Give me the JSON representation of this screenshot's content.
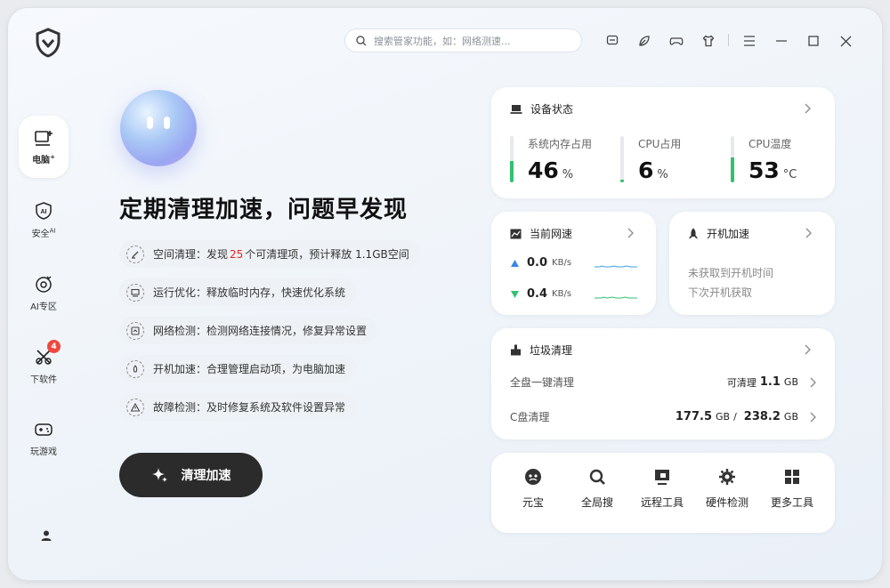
{
  "search": {
    "placeholder": "搜索管家功能，如：网络测速..."
  },
  "titlebar_icons": [
    "feedback-icon",
    "skin-icon",
    "game-controller-icon",
    "shirt-icon",
    "menu-icon",
    "minimize-icon",
    "maximize-icon",
    "close-icon"
  ],
  "sidebar": {
    "items": [
      {
        "label": "电脑",
        "sup": "+",
        "icon": "monitor-plus-icon",
        "active": true
      },
      {
        "label": "安全",
        "sup": "AI",
        "icon": "ai-shield-icon"
      },
      {
        "label": "AI专区",
        "icon": "ai-zone-icon"
      },
      {
        "label": "下软件",
        "icon": "download-software-icon",
        "badge": "4"
      },
      {
        "label": "玩游戏",
        "icon": "gamepad-icon"
      }
    ]
  },
  "main": {
    "headline": "定期清理加速，问题早发现",
    "features": [
      {
        "prefix": "空间清理：发现 ",
        "highlight": "25",
        "suffix": " 个可清理项，预计释放 1.1GB空间"
      },
      {
        "prefix": "运行优化：释放临时内存，快速优化系统",
        "highlight": "",
        "suffix": ""
      },
      {
        "prefix": "网络检测：检测网络连接情况，修复异常设置",
        "highlight": "",
        "suffix": ""
      },
      {
        "prefix": "开机加速：合理管理启动项，为电脑加速",
        "highlight": "",
        "suffix": ""
      },
      {
        "prefix": "故障检测：及时修复系统及软件设置异常",
        "highlight": "",
        "suffix": ""
      }
    ],
    "cta": "清理加速"
  },
  "device": {
    "title": "设备状态",
    "stats": [
      {
        "label": "系统内存占用",
        "value": "46",
        "unit": "%",
        "level": 0.46
      },
      {
        "label": "CPU占用",
        "value": "6",
        "unit": "%",
        "level": 0.06
      },
      {
        "label": "CPU温度",
        "value": "53",
        "unit": "°C",
        "level": 0.53
      }
    ]
  },
  "network": {
    "title": "当前网速",
    "up": {
      "value": "0.0",
      "unit": "KB/s"
    },
    "down": {
      "value": "0.4",
      "unit": "KB/s"
    }
  },
  "boot": {
    "title": "开机加速",
    "line1": "未获取到开机时间",
    "line2": "下次开机获取"
  },
  "junk": {
    "title": "垃圾清理",
    "rows": [
      {
        "label": "全盘一键清理",
        "pre": "可清理",
        "value": "1.1",
        "unit": "GB"
      },
      {
        "label": "C盘清理",
        "used": "177.5",
        "used_unit": "GB",
        "slash": "/",
        "total": "238.2",
        "total_unit": "GB"
      }
    ]
  },
  "tools": [
    {
      "label": "元宝",
      "icon": "yuanbao-icon"
    },
    {
      "label": "全局搜",
      "icon": "global-search-icon"
    },
    {
      "label": "远程工具",
      "icon": "remote-tool-icon"
    },
    {
      "label": "硬件检测",
      "icon": "hardware-detect-icon"
    },
    {
      "label": "更多工具",
      "icon": "more-tools-icon"
    }
  ],
  "colors": {
    "accent_green": "#2fc26f",
    "highlight_red": "#e22222",
    "cta_bg": "#2b2b2b",
    "up_arrow": "#3a86e8",
    "down_arrow": "#2fc26f"
  }
}
